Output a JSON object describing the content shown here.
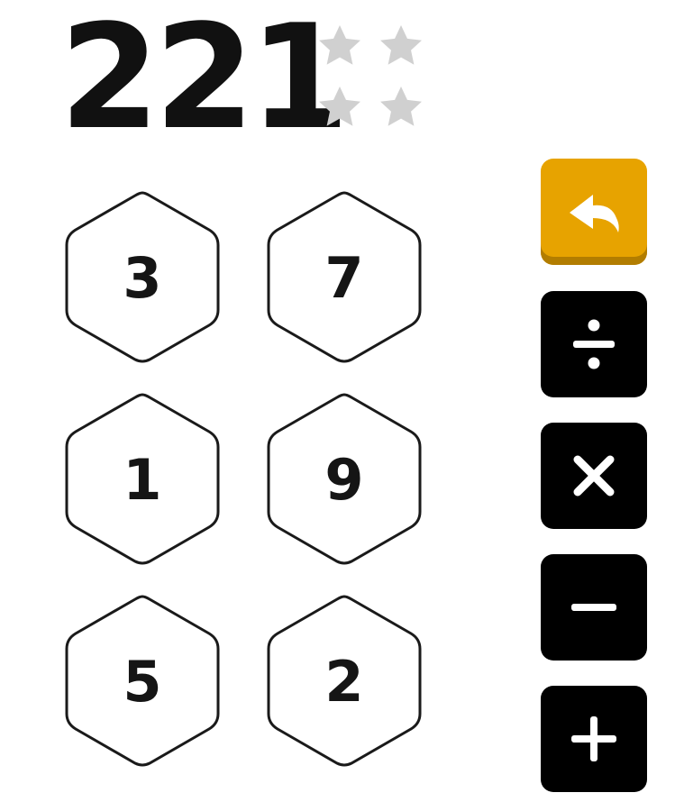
{
  "target": "221",
  "stars": {
    "earned": 0,
    "total": 4,
    "empty_color": "#d0d0d0"
  },
  "tiles": [
    {
      "value": "3"
    },
    {
      "value": "7"
    },
    {
      "value": "1"
    },
    {
      "value": "9"
    },
    {
      "value": "5"
    },
    {
      "value": "2"
    }
  ],
  "operators": [
    {
      "name": "undo",
      "icon": "undo-arrow-icon",
      "color": "#e7a300"
    },
    {
      "name": "divide",
      "icon": "divide-icon",
      "color": "#000000"
    },
    {
      "name": "multiply",
      "icon": "multiply-icon",
      "color": "#000000"
    },
    {
      "name": "subtract",
      "icon": "minus-icon",
      "color": "#000000"
    },
    {
      "name": "add",
      "icon": "plus-icon",
      "color": "#000000"
    }
  ]
}
